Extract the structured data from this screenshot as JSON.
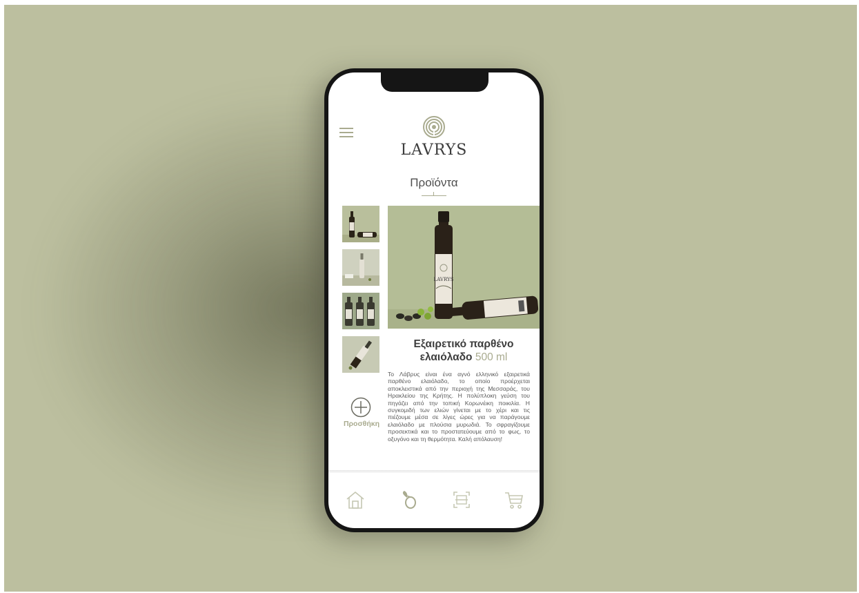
{
  "app": {
    "brand": "LAVRYS",
    "colors": {
      "background": "#bcbf9f",
      "accent": "#a9ab8f",
      "phone_frame": "#151515",
      "text": "#3d3d3d"
    }
  },
  "header": {
    "menu_icon": "hamburger-icon",
    "logo_icon": "tree-rings-logo",
    "logo_text": "LAVRYS"
  },
  "page": {
    "title": "Προϊόντα"
  },
  "gallery": {
    "thumbnails": [
      {
        "name": "thumbnail-bottles-standing-lying"
      },
      {
        "name": "thumbnail-bottle-table"
      },
      {
        "name": "thumbnail-three-bottles"
      },
      {
        "name": "thumbnail-bottle-tilted"
      }
    ],
    "add_icon": "plus-circle-icon",
    "add_label": "Προσθήκη"
  },
  "product": {
    "title_line1": "Εξαιρετικό παρθένο",
    "title_line2": "ελαιόλαδο",
    "volume": "500 ml",
    "description": "Το Λάβρυς είναι ένα αγνό ελληνικό εξαιρετικά παρθένο ελαιόλαδο, το οποίο προέρχεται αποκλειστικά από την περιοχή της Μεσσαράς, του Ηρακλείου της Κρήτης. Η πολύπλοκη γεύση του πηγάζει από την τοπική Κορωνέικη ποικιλία. Η συγκομιδή των ελιών γίνεται με το χέρι και τις πιέζουμε μέσα σε λίγες ώρες για να παράγουμε ελαιόλαδο με πλούσια μυρωδιά. Το σφραγίζουμε προσεκτικά και το προστατεύουμε από το φως, το οξυγόνο και τη θερμότητα. Καλή απόλαυση!",
    "bottle_label": "LAVRYS"
  },
  "bottom_nav": {
    "items": [
      {
        "icon": "home-icon"
      },
      {
        "icon": "olive-icon"
      },
      {
        "icon": "scan-icon"
      },
      {
        "icon": "cart-icon"
      }
    ]
  }
}
